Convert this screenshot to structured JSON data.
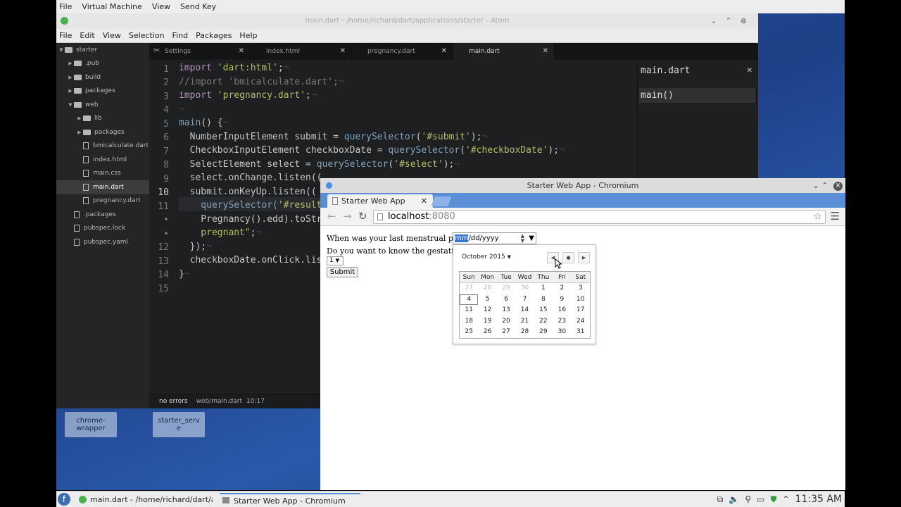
{
  "vm_menu": [
    "File",
    "Virtual Machine",
    "View",
    "Send Key"
  ],
  "desktop_icons": [
    {
      "label": "chrome-\nwrapper"
    },
    {
      "label": "starter_serv\ne"
    }
  ],
  "atom": {
    "title": "main.dart - /home/richard/dart/applications/starter - Atom",
    "menu": [
      "File",
      "Edit",
      "View",
      "Selection",
      "Find",
      "Packages",
      "Help"
    ],
    "tree": [
      {
        "label": "starter",
        "type": "folder",
        "depth": 0,
        "expanded": true
      },
      {
        "label": ".pub",
        "type": "folder",
        "depth": 1
      },
      {
        "label": "build",
        "type": "folder",
        "depth": 1
      },
      {
        "label": "packages",
        "type": "folder",
        "depth": 1
      },
      {
        "label": "web",
        "type": "folder",
        "depth": 1,
        "expanded": true
      },
      {
        "label": "lib",
        "type": "folder",
        "depth": 2
      },
      {
        "label": "packages",
        "type": "folder",
        "depth": 2
      },
      {
        "label": "bmicalculate.dart",
        "type": "file",
        "depth": 2
      },
      {
        "label": "index.html",
        "type": "file",
        "depth": 2
      },
      {
        "label": "main.css",
        "type": "file",
        "depth": 2
      },
      {
        "label": "main.dart",
        "type": "file",
        "depth": 2,
        "selected": true
      },
      {
        "label": "pregnancy.dart",
        "type": "file",
        "depth": 2
      },
      {
        "label": ".packages",
        "type": "file",
        "depth": 1
      },
      {
        "label": "pubspec.lock",
        "type": "file",
        "depth": 1
      },
      {
        "label": "pubspec.yaml",
        "type": "file",
        "depth": 1
      }
    ],
    "tabs": [
      {
        "label": "Settings",
        "icon": "wrench-icon"
      },
      {
        "label": "index.html"
      },
      {
        "label": "pregnancy.dart"
      },
      {
        "label": "main.dart",
        "active": true
      }
    ],
    "line_numbers": [
      "1",
      "2",
      "3",
      "4",
      "5",
      "6",
      "7",
      "8",
      "9",
      "10",
      "11",
      "•",
      "•",
      "12",
      "13",
      "14",
      "15"
    ],
    "code": [
      [
        [
          "import ",
          "#b294bb"
        ],
        [
          "'dart:html'",
          "#b5bd68"
        ],
        [
          ";",
          "#c5c8c6"
        ],
        [
          "¬",
          "#444"
        ]
      ],
      [
        [
          "//import 'bmicalculate.dart';",
          "#7a7a7a"
        ],
        [
          "¬",
          "#444"
        ]
      ],
      [
        [
          "import ",
          "#b294bb"
        ],
        [
          "'pregnancy.dart'",
          "#b5bd68"
        ],
        [
          ";",
          "#c5c8c6"
        ],
        [
          "¬",
          "#444"
        ]
      ],
      [
        [
          "¬",
          "#444"
        ]
      ],
      [
        [
          "main",
          "#81a2be"
        ],
        [
          "() {",
          "#c5c8c6"
        ],
        [
          "¬",
          "#444"
        ]
      ],
      [
        [
          "  NumberInputElement submit = ",
          "#c5c8c6"
        ],
        [
          "querySelector",
          "#81a2be"
        ],
        [
          "(",
          "#c5c8c6"
        ],
        [
          "'#submit'",
          "#b5bd68"
        ],
        [
          ");",
          "#c5c8c6"
        ],
        [
          "¬",
          "#444"
        ]
      ],
      [
        [
          "  CheckboxInputElement checkboxDate = ",
          "#c5c8c6"
        ],
        [
          "querySelector",
          "#81a2be"
        ],
        [
          "(",
          "#c5c8c6"
        ],
        [
          "'#checkboxDate'",
          "#b5bd68"
        ],
        [
          ");",
          "#c5c8c6"
        ],
        [
          "¬",
          "#444"
        ]
      ],
      [
        [
          "  SelectElement select = ",
          "#c5c8c6"
        ],
        [
          "querySelector",
          "#81a2be"
        ],
        [
          "(",
          "#c5c8c6"
        ],
        [
          "'#select'",
          "#b5bd68"
        ],
        [
          ");",
          "#c5c8c6"
        ],
        [
          "¬",
          "#444"
        ]
      ],
      [
        [
          "  select.onChange.listen((",
          "#c5c8c6"
        ]
      ],
      [
        [
          "  submit.onKeyUp.listen((",
          "#c5c8c6"
        ]
      ],
      [
        [
          "    querySelector(",
          "#81a2be"
        ],
        [
          "'#result",
          "#b5bd68"
        ]
      ],
      [
        [
          "    Pregnancy().edd).toStr",
          "#c5c8c6"
        ]
      ],
      [
        [
          "    pregnant\"",
          "#b5bd68"
        ],
        [
          ";",
          "#c5c8c6"
        ],
        [
          "¬",
          "#444"
        ]
      ],
      [
        [
          "  });",
          "#c5c8c6"
        ],
        [
          "¬",
          "#444"
        ]
      ],
      [
        [
          "  checkboxDate.onClick.lis",
          "#c5c8c6"
        ]
      ],
      [
        [
          "}",
          "#c5c8c6"
        ],
        [
          "¬",
          "#444"
        ]
      ],
      [
        [
          "",
          "#c5c8c6"
        ]
      ]
    ],
    "outline_title": "main.dart",
    "outline_item": "main()",
    "status": {
      "errors": "no errors",
      "path": "web/main.dart",
      "cursor": "10:17"
    }
  },
  "chromium": {
    "title": "Starter Web App - Chromium",
    "tab_label": "Starter Web App",
    "url_host": "localhost",
    "url_port": ":8080",
    "question1": "When was your last menstrual period:",
    "date_mm": "mm",
    "date_rest": "/dd/yyyy",
    "question2": "Do you want to know the gestational a",
    "select_value": "1",
    "submit_label": "Submit"
  },
  "calendar": {
    "month": "October 2015",
    "days": [
      "Sun",
      "Mon",
      "Tue",
      "Wed",
      "Thu",
      "Fri",
      "Sat"
    ],
    "weeks": [
      [
        {
          "d": "27",
          "m": 1
        },
        {
          "d": "28",
          "m": 1
        },
        {
          "d": "29",
          "m": 1
        },
        {
          "d": "30",
          "m": 1
        },
        {
          "d": "1"
        },
        {
          "d": "2"
        },
        {
          "d": "3"
        }
      ],
      [
        {
          "d": "4",
          "t": 1
        },
        {
          "d": "5"
        },
        {
          "d": "6"
        },
        {
          "d": "7"
        },
        {
          "d": "8"
        },
        {
          "d": "9"
        },
        {
          "d": "10"
        }
      ],
      [
        {
          "d": "11"
        },
        {
          "d": "12"
        },
        {
          "d": "13"
        },
        {
          "d": "14"
        },
        {
          "d": "15"
        },
        {
          "d": "16"
        },
        {
          "d": "17"
        }
      ],
      [
        {
          "d": "18"
        },
        {
          "d": "19"
        },
        {
          "d": "20"
        },
        {
          "d": "21"
        },
        {
          "d": "22"
        },
        {
          "d": "23"
        },
        {
          "d": "24"
        }
      ],
      [
        {
          "d": "25"
        },
        {
          "d": "26"
        },
        {
          "d": "27"
        },
        {
          "d": "28"
        },
        {
          "d": "29"
        },
        {
          "d": "30"
        },
        {
          "d": "31"
        }
      ]
    ]
  },
  "taskbar": {
    "items": [
      {
        "label": "main.dart - /home/richard/dart/app",
        "icon": "atom-icon"
      },
      {
        "label": "Starter Web App - Chromium",
        "icon": "chromium-icon"
      }
    ],
    "clock": "11:35 AM"
  }
}
